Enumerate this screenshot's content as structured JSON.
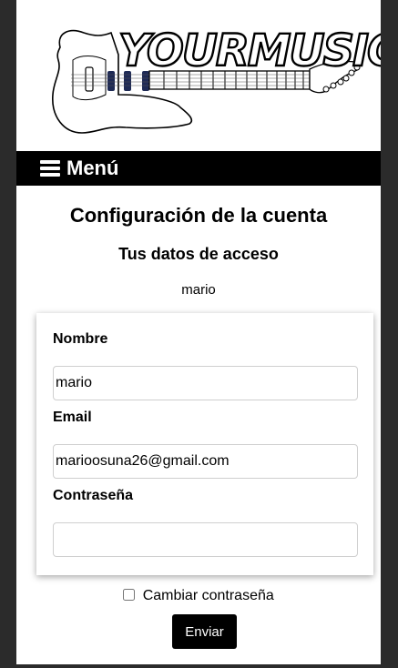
{
  "logo": {
    "text": "YOURMUSIC"
  },
  "menu": {
    "label": "Menú"
  },
  "page": {
    "title": "Configuración de la cuenta",
    "section_title": "Tus datos de acceso",
    "username": "mario"
  },
  "form": {
    "name_label": "Nombre",
    "name_value": "mario",
    "email_label": "Email",
    "email_value": "marioosuna26@gmail.com",
    "password_label": "Contraseña",
    "password_value": "",
    "change_password_label": "Cambiar contraseña",
    "change_password_checked": false,
    "submit_label": "Enviar"
  }
}
